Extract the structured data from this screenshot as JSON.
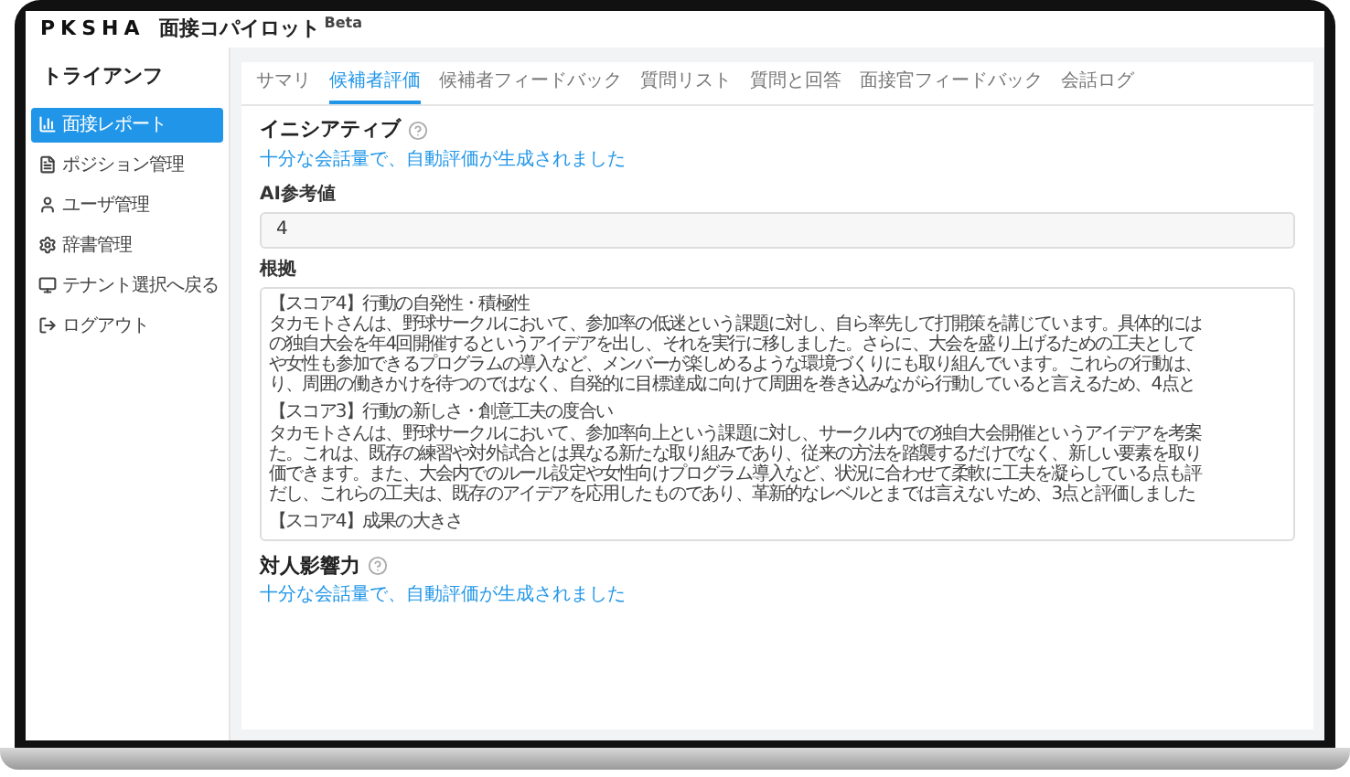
{
  "header": {
    "logo": "PKSHA",
    "product": "面接コパイロット",
    "badge": "Beta"
  },
  "sidebar": {
    "title": "トライアンフ",
    "items": [
      {
        "label": "面接レポート",
        "selected": true
      },
      {
        "label": "ポジション管理",
        "selected": false
      },
      {
        "label": "ユーザ管理",
        "selected": false
      },
      {
        "label": "辞書管理",
        "selected": false
      },
      {
        "label": "テナント選択へ戻る",
        "selected": false
      },
      {
        "label": "ログアウト",
        "selected": false
      }
    ]
  },
  "tabs": [
    {
      "label": "サマリ",
      "selected": false
    },
    {
      "label": "候補者評価",
      "selected": true
    },
    {
      "label": "候補者フィードバック",
      "selected": false
    },
    {
      "label": "質問リスト",
      "selected": false
    },
    {
      "label": "質問と回答",
      "selected": false
    },
    {
      "label": "面接官フィードバック",
      "selected": false
    },
    {
      "label": "会話ログ",
      "selected": false
    }
  ],
  "sections": [
    {
      "title": "イニシアティブ",
      "note": "十分な会話量で、自動評価が生成されました",
      "fields": [
        {
          "kind": "input",
          "label": "AI参考値",
          "value": "4"
        },
        {
          "kind": "textarea",
          "label": "根拠",
          "paragraphs": [
            {
              "heading": "【スコア4】行動の自発性・積極性",
              "lines": [
                "タカモトさんは、野球サークルにおいて、参加率の低迷という課題に対し、自ら率先して打開策を講じています。具体的には",
                "の独自大会を年4回開催するというアイデアを出し、それを実行に移しました。さらに、大会を盛り上げるための工夫として",
                "や女性も参加できるプログラムの導入など、メンバーが楽しめるような環境づくりにも取り組んでいます。これらの行動は、",
                "り、周囲の働きかけを待つのではなく、自発的に目標達成に向けて周囲を巻き込みながら行動していると言えるため、4点と"
              ]
            },
            {
              "heading": "【スコア3】行動の新しさ・創意工夫の度合い",
              "lines": [
                "タカモトさんは、野球サークルにおいて、参加率向上という課題に対し、サークル内での独自大会開催というアイデアを考案",
                "た。これは、既存の練習や対外試合とは異なる新たな取り組みであり、従来の方法を踏襲するだけでなく、新しい要素を取り",
                "価できます。また、大会内でのルール設定や女性向けプログラム導入など、状況に合わせて柔軟に工夫を凝らしている点も評",
                "だし、これらの工夫は、既存のアイデアを応用したものであり、革新的なレベルとまでは言えないため、3点と評価しました"
              ]
            },
            {
              "heading": "【スコア4】成果の大きさ"
            }
          ]
        }
      ]
    },
    {
      "title": "対人影響力",
      "note": "十分な会話量で、自動評価が生成されました"
    }
  ]
}
